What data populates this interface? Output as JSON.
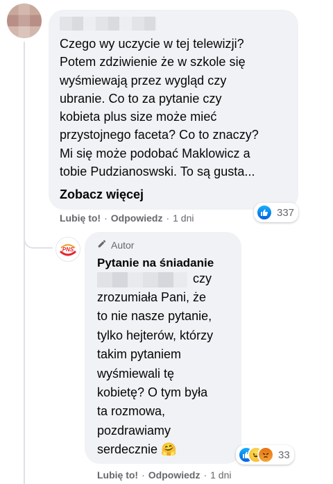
{
  "comment": {
    "text": "Czego wy uczycie w tej telewizji?\nPotem zdziwienie że w szkole się\nwyśmiewają przez wygląd czy\nubranie. Co to za pytanie czy\nkobieta plus size może mieć\nprzystojnego faceta? Co to znaczy?\nMi się może podobać Maklowicz a\ntobie Pudzianoswski. To są gusta...",
    "see_more": "Zobacz więcej",
    "reaction_count": "337",
    "actions": {
      "like": "Lubię to!",
      "reply": "Odpowiedz",
      "sep": "·",
      "time": "1 dni"
    }
  },
  "reply": {
    "badge": "Autor",
    "author": "Pytanie na śniadanie",
    "first_line_tail": "czy",
    "text": "zrozumiała Pani, że\nto nie nasze pytanie,\ntylko hejterów, którzy\ntakim pytaniem\nwyśmiewali tę\nkobietę? O tym była\nta rozmowa,\npozdrawiamy\nserdecznie 🤗",
    "reaction_count": "33",
    "avatar_text": "PNS",
    "actions": {
      "like": "Lubię to!",
      "reply": "Odpowiedz",
      "sep": "·",
      "time": "1 dni"
    }
  },
  "colors": {
    "bubble": "#f0f2f5",
    "meta": "#65676b",
    "like_blue": "#1877f2",
    "brand_red": "#e3262f"
  },
  "icons": [
    "thumbs-up-icon",
    "haha-icon",
    "angry-icon",
    "pencil-icon"
  ]
}
